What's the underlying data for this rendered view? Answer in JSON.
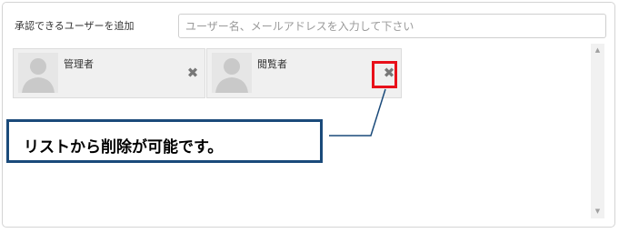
{
  "add_user": {
    "label": "承認できるユーザーを追加",
    "placeholder": "ユーザー名、メールアドレスを入力して下さい"
  },
  "cards": [
    {
      "label": "管理者",
      "remove_icon": "close-icon"
    },
    {
      "label": "閲覧者",
      "remove_icon": "close-icon"
    }
  ],
  "annotation": {
    "text": "リストから削除が可能です。",
    "border_color": "#1a4a7a",
    "highlight_color": "#e8101a"
  },
  "scrollbar": {
    "up": "▲",
    "down": "▼"
  },
  "remove_glyph": "✖"
}
